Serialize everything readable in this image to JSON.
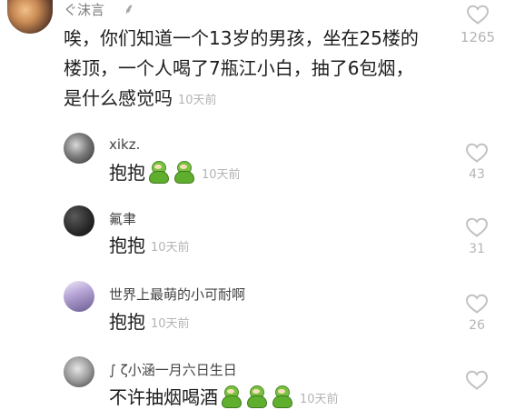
{
  "main_comment": {
    "username": "ぐ沫言",
    "flourish": "⸙",
    "line1": "唉，你们知道一个13岁的男孩，坐在25楼的",
    "line2": "楼顶，一个人喝了7瓶江小白，抽了6包烟，",
    "line3": "是什么感觉吗",
    "time": "10天前",
    "likes": "1265"
  },
  "replies": [
    {
      "username": "xikz.",
      "text": "抱抱",
      "emoji_count": 2,
      "time": "10天前",
      "likes": "43"
    },
    {
      "username": "氟聿",
      "text": "抱抱",
      "emoji_count": 0,
      "time": "10天前",
      "likes": "31"
    },
    {
      "username": "世界上最萌的小可耐啊",
      "text": "抱抱",
      "emoji_count": 0,
      "time": "10天前",
      "likes": "26"
    },
    {
      "username": "∫ ζ小涵一月六日生日",
      "text": "不许抽烟喝酒",
      "emoji_count": 3,
      "time": "10天前",
      "likes": ""
    }
  ],
  "icons": {
    "heart": "heart-outline-icon",
    "emoji": "green-hug-emoji-icon"
  },
  "colors": {
    "heart_stroke": "#c2c2c2",
    "time_text": "#b4b4b4",
    "emoji_green": "#5fae2e"
  }
}
